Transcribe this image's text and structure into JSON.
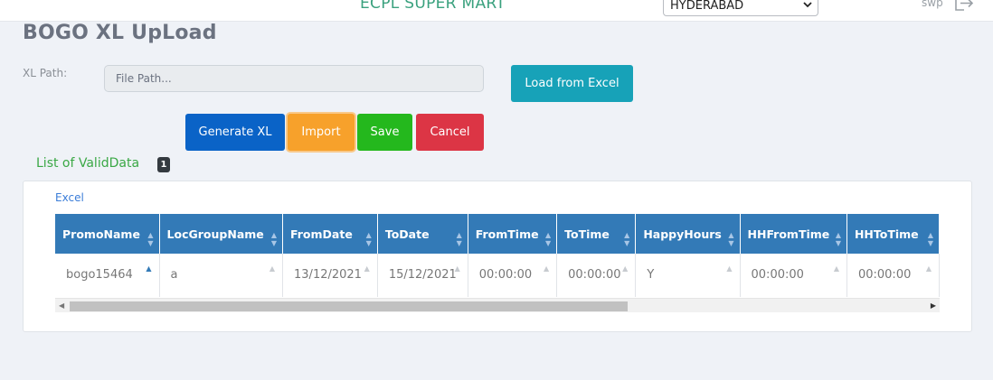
{
  "header": {
    "brand": "ECPL SUPER MART",
    "location_selected": "HYDERABAD",
    "user": "swp",
    "logout_icon": "logout-icon"
  },
  "page": {
    "title": "BOGO XL UpLoad"
  },
  "form": {
    "xl_path_label": "XL Path:",
    "xl_path_value": "",
    "xl_path_placeholder": "File Path...",
    "load_button": "Load from Excel",
    "generate_button": "Generate XL",
    "import_button": "Import",
    "save_button": "Save",
    "cancel_button": "Cancel"
  },
  "list": {
    "title": "List of ValidData",
    "count": "1",
    "tab_link": "Excel",
    "columns": [
      "PromoName",
      "LocGroupName",
      "FromDate",
      "ToDate",
      "FromTime",
      "ToTime",
      "HappyHours",
      "HHFromTime",
      "HHToTime"
    ],
    "rows": [
      [
        "bogo15464",
        "a",
        "13/12/2021",
        "15/12/2021",
        "00:00:00",
        "00:00:00",
        "Y",
        "00:00:00",
        "00:00:00"
      ]
    ]
  }
}
